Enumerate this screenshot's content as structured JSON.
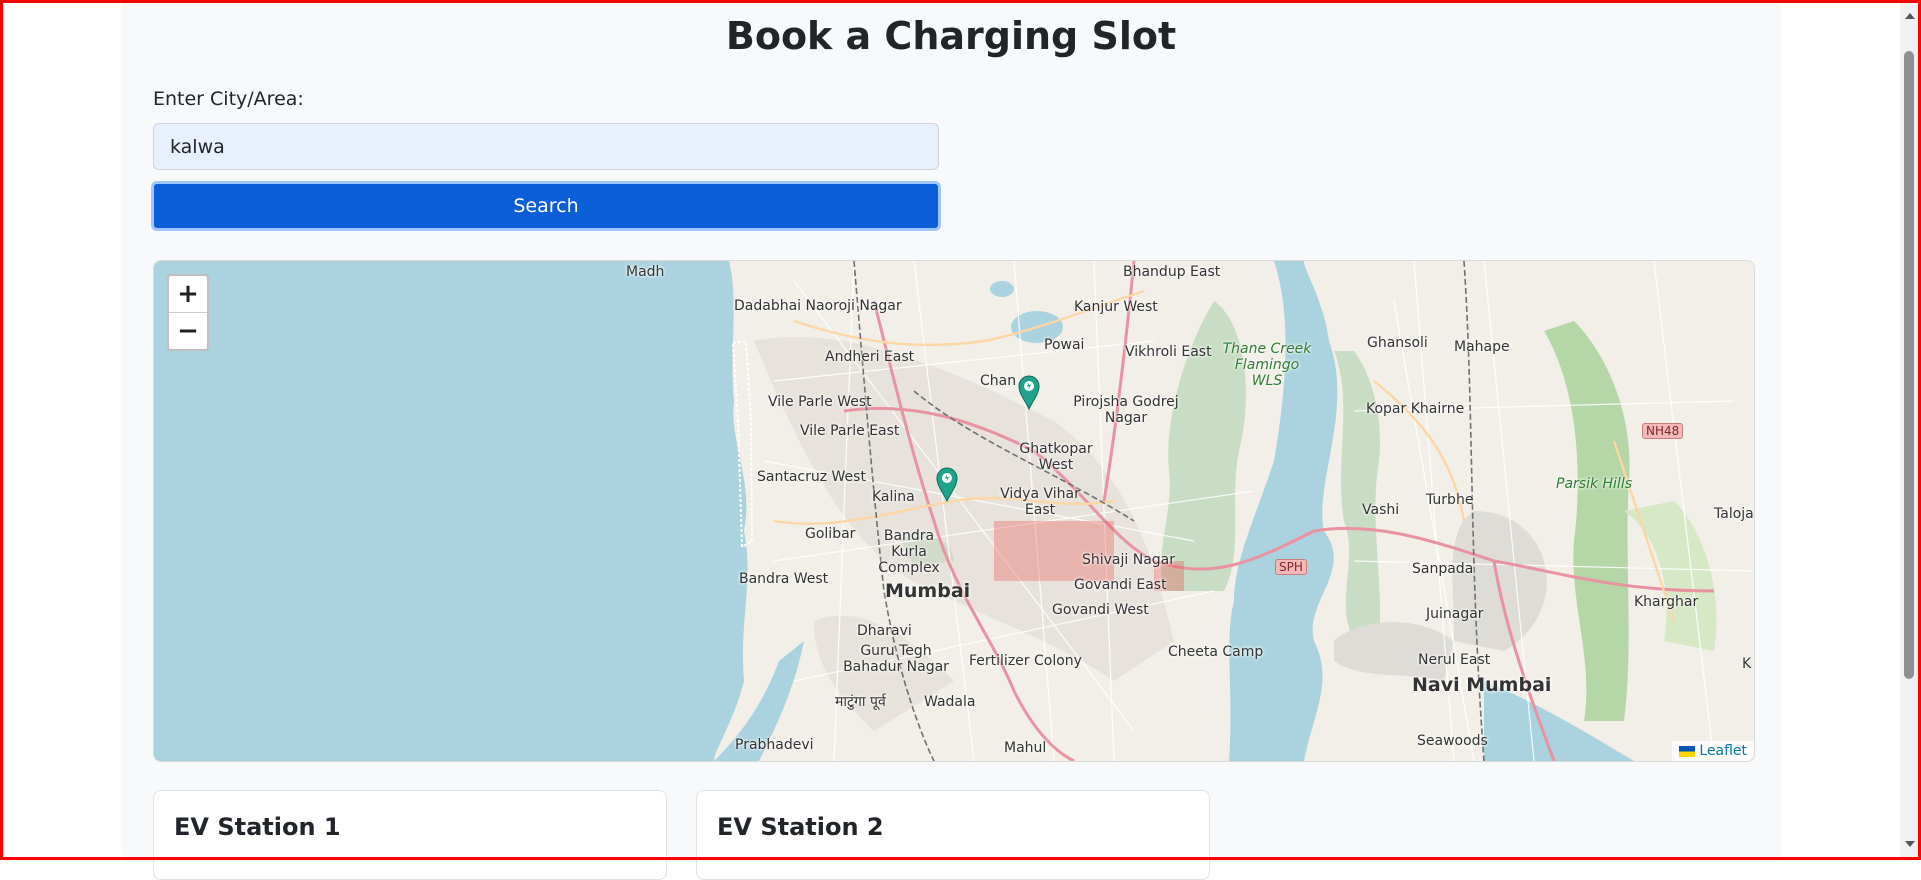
{
  "page": {
    "title": "Book a Charging Slot",
    "search_label": "Enter City/Area:",
    "search_value": "kalwa",
    "search_button": "Search"
  },
  "map": {
    "zoom_in": "+",
    "zoom_out": "−",
    "attribution": "Leaflet",
    "places": [
      "Madh",
      "Dadabhai Naoroji Nagar",
      "Andheri East",
      "Bhandup East",
      "Kanjur West",
      "Powai",
      "Vikhroli East",
      "Thane Creek Flamingo WLS",
      "Ghansoli",
      "Mahape",
      "Vile Parle West",
      "Chan",
      "Pirojsha Godrej Nagar",
      "Kopar Khairne",
      "NH48",
      "Vile Parle East",
      "Ghatkopar West",
      "Santacruz West",
      "Parsik Hills",
      "Kalina",
      "Vidya Vihar East",
      "Vashi",
      "Turbhe",
      "Taloja",
      "Golibar",
      "Bandra Kurla Complex",
      "Shivaji Nagar",
      "SPH",
      "Sanpada",
      "Bandra West",
      "Mumbai",
      "Govandi East",
      "Kharghar",
      "Govandi West",
      "Juinagar",
      "Dharavi",
      "Cheeta Camp",
      "Guru Tegh Bahadur Nagar",
      "Fertilizer Colony",
      "Nerul East",
      "Navi Mumbai",
      "माटुंगा पूर्व",
      "Wadala",
      "Prabhadevi",
      "Mahul",
      "Seawoods",
      "K"
    ]
  },
  "stations": [
    {
      "name": "EV Station 1"
    },
    {
      "name": "EV Station 2"
    }
  ],
  "colors": {
    "primary_button": "#0b5ed7",
    "input_bg": "#e8f0fe",
    "water": "#aad3df",
    "marker": "#1fa38a",
    "frame_border": "#ff0000"
  }
}
